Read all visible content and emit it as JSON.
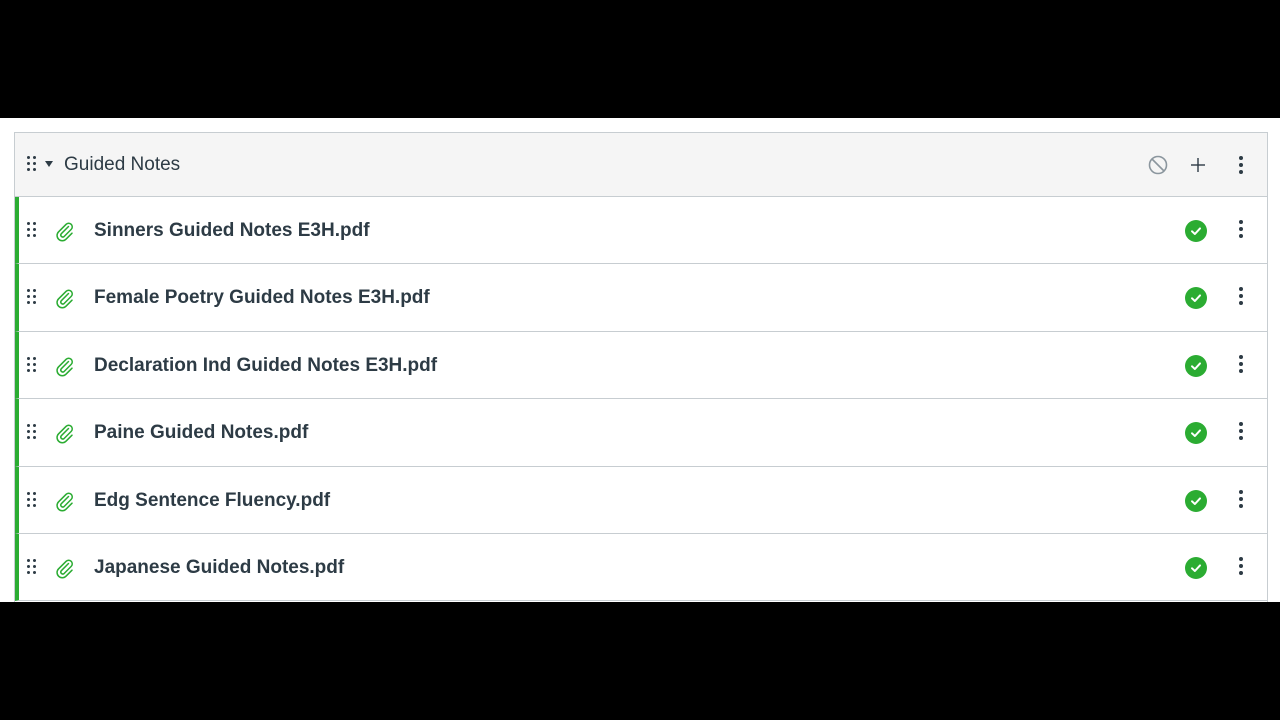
{
  "module": {
    "title": "Guided Notes",
    "header_icons": [
      "drag-handle-icon",
      "collapse-caret-icon",
      "unpublished-icon",
      "add-icon",
      "more-icon"
    ],
    "items": [
      {
        "title": "Sinners Guided Notes E3H.pdf",
        "type_icon": "paperclip-icon",
        "status": "published"
      },
      {
        "title": "Female Poetry Guided Notes E3H.pdf",
        "type_icon": "paperclip-icon",
        "status": "published"
      },
      {
        "title": "Declaration Ind Guided Notes E3H.pdf",
        "type_icon": "paperclip-icon",
        "status": "published"
      },
      {
        "title": "Paine Guided Notes.pdf",
        "type_icon": "paperclip-icon",
        "status": "published"
      },
      {
        "title": "Edg Sentence Fluency.pdf",
        "type_icon": "paperclip-icon",
        "status": "published"
      },
      {
        "title": "Japanese Guided Notes.pdf",
        "type_icon": "paperclip-icon",
        "status": "published"
      }
    ]
  },
  "colors": {
    "published_green": "#2bac32",
    "text_dark": "#2d3b45",
    "header_bg": "#f5f5f5",
    "border": "#c7cdd1",
    "letterbox": "#000000"
  }
}
